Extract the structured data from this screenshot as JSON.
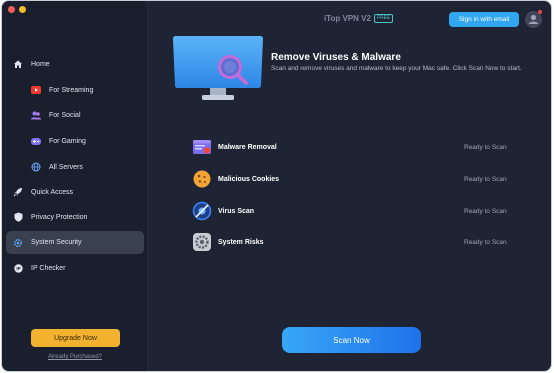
{
  "app": {
    "title": "iTop VPN V2",
    "badge": "FREE",
    "sign_in_label": "Sign in with email"
  },
  "colors": {
    "accent_blue": "#2a8cf0",
    "upgrade_yellow": "#f2b12e",
    "sidebar_bg": "#1a1f2d",
    "main_bg": "#1e2434",
    "active_item_bg": "#39404f"
  },
  "sidebar": {
    "items": [
      {
        "label": "Home",
        "icon": "home-icon"
      },
      {
        "label": "For Streaming",
        "icon": "youtube-icon"
      },
      {
        "label": "For Social",
        "icon": "people-icon"
      },
      {
        "label": "For Gaming",
        "icon": "gamepad-icon"
      },
      {
        "label": "All Servers",
        "icon": "globe-icon"
      },
      {
        "label": "Quick Access",
        "icon": "rocket-icon"
      },
      {
        "label": "Privacy Protection",
        "icon": "shield-icon"
      },
      {
        "label": "System Security",
        "icon": "gear-icon",
        "active": true
      },
      {
        "label": "IP Checker",
        "icon": "ip-icon"
      }
    ],
    "upgrade_label": "Upgrade Now",
    "purchased_label": "Already Purchased?"
  },
  "header": {
    "title": "Remove Viruses & Malware",
    "description": "Scan and remove viruses and malware to keep your Mac safe. Click Scan Now to start."
  },
  "scan_items": [
    {
      "name": "Malware Removal",
      "status": "Ready to Scan",
      "icon": "malware-window-icon"
    },
    {
      "name": "Malicious Cookies",
      "status": "Ready to Scan",
      "icon": "cookie-icon"
    },
    {
      "name": "Virus Scan",
      "status": "Ready to Scan",
      "icon": "virus-blocked-icon"
    },
    {
      "name": "System Risks",
      "status": "Ready to Scan",
      "icon": "system-gear-icon"
    }
  ],
  "scan_button_label": "Scan Now"
}
